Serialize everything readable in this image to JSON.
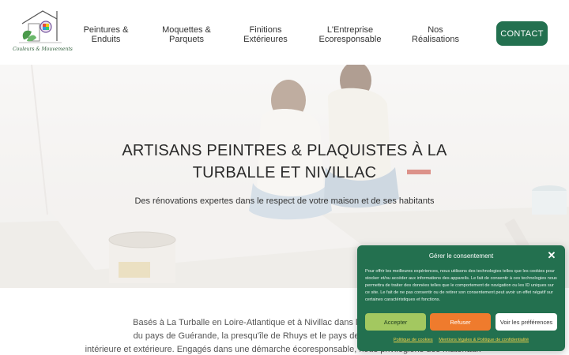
{
  "header": {
    "logo_text": "Couleurs & Mouvements",
    "nav": [
      {
        "line1": "Peintures &",
        "line2": "Enduits"
      },
      {
        "line1": "Moquettes &",
        "line2": "Parquets"
      },
      {
        "line1": "Finitions",
        "line2": "Extérieures"
      },
      {
        "line1": "L'Entreprise",
        "line2": "Ecoresponsable"
      },
      {
        "line1": "Nos",
        "line2": "Réalisations"
      }
    ],
    "contact_label": "CONTACT"
  },
  "hero": {
    "title_line1": "ARTISANS PEINTRES & PLAQUISTES À LA",
    "title_line2": "TURBALLE ET NIVILLAC",
    "subtitle": "Des rénovations expertes dans le respect de votre maison et de ses habitants"
  },
  "intro": {
    "line1": "Basés à La Turballe en Loire-Atlantique et à Nivillac dans le Morbihan, Sophie",
    "line2": "du pays de Guérande, la presqu'île de Rhuys et le pays de La Roche-Bernard",
    "line3": "intérieure et extérieure. Engagés dans une démarche écoresponsable, nous privilégions des matériaux sains,"
  },
  "cookie": {
    "title": "Gérer le consentement",
    "close": "✕",
    "text": "Pour offrir les meilleures expériences, nous utilisons des technologies telles que les cookies pour stocker et/ou accéder aux informations des appareils. Le fait de consentir à ces technologies nous permettra de traiter des données telles que le comportement de navigation ou les ID uniques sur ce site. Le fait de ne pas consentir ou de retirer son consentement peut avoir un effet négatif sur certaines caractéristiques et fonctions.",
    "accept": "Accepter",
    "refuse": "Refuser",
    "prefs": "Voir les préférences",
    "link_cookies": "Politique de cookies",
    "link_legal": "Mentions légales & Politique de confidentialité"
  },
  "colors": {
    "brand_green": "#23704f",
    "accept_green": "#a3c860",
    "refuse_orange": "#ef7b2d",
    "link_yellow": "#f5d34a"
  }
}
